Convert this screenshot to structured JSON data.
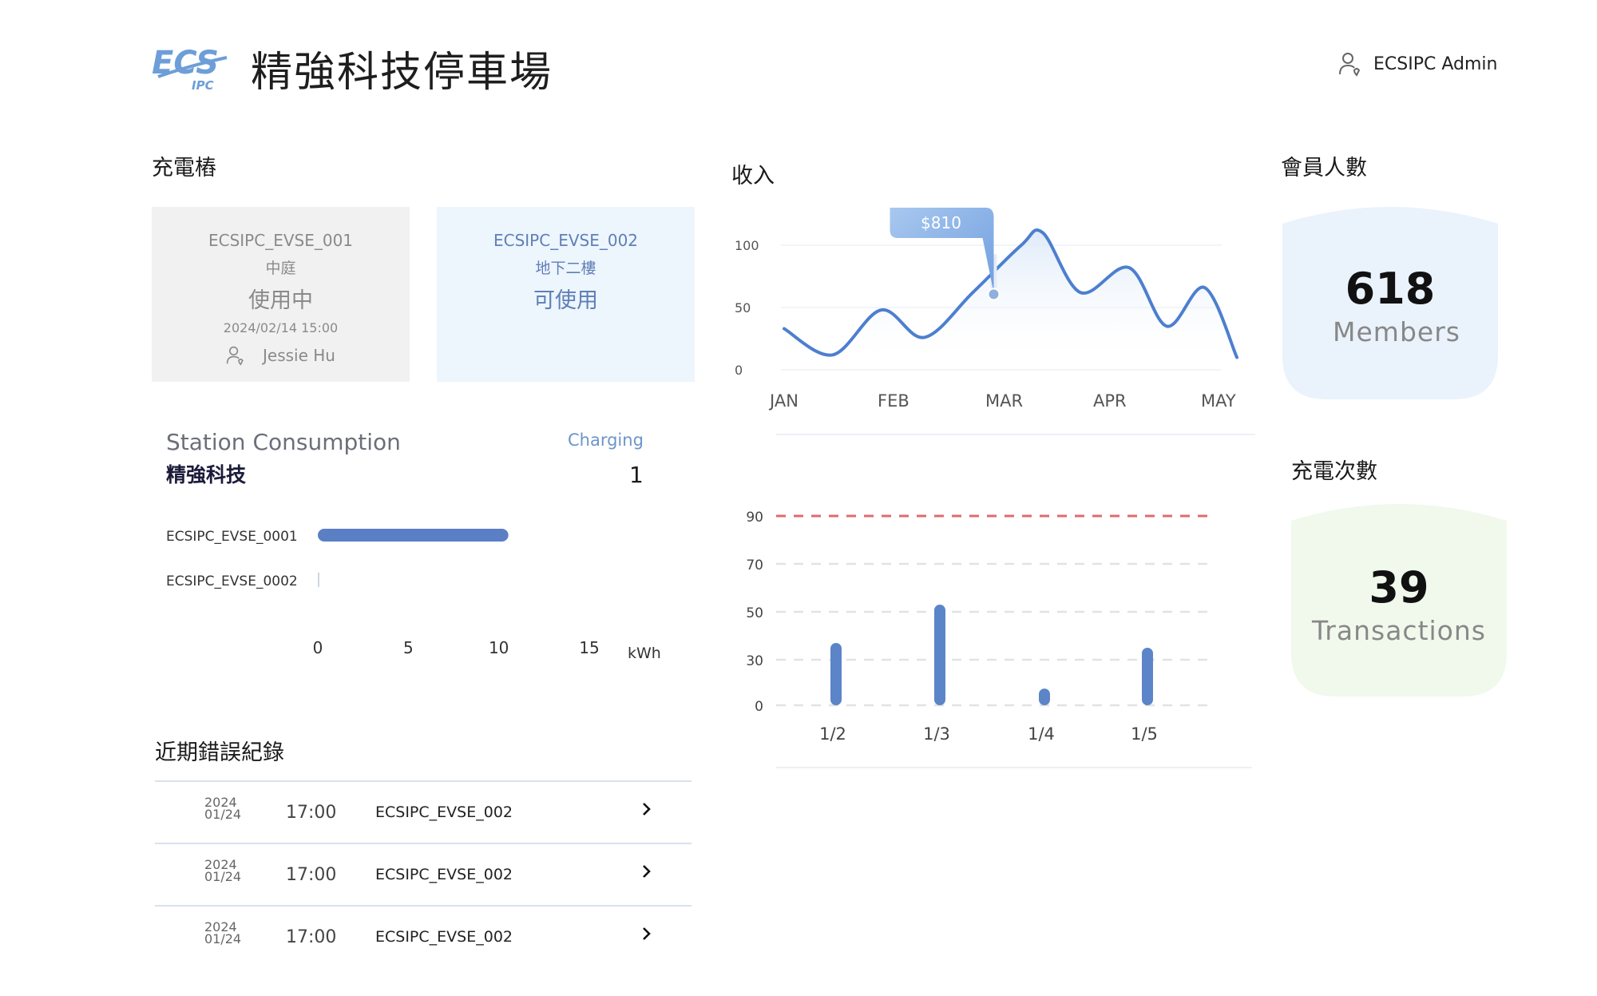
{
  "header": {
    "logo_text": "ECS",
    "logo_sub": "IPC",
    "title": "精強科技停車場",
    "user_name": "ECSIPC Admin",
    "user_icon": "user-icon"
  },
  "chargers": {
    "title": "充電樁",
    "cards": [
      {
        "name": "ECSIPC_EVSE_001",
        "location": "中庭",
        "status": "使用中",
        "time": "2024/02/14  15:00",
        "user": "Jessie Hu"
      },
      {
        "name": "ECSIPC_EVSE_002",
        "location": "地下二樓",
        "status": "可使用"
      }
    ]
  },
  "station": {
    "title": "Station Consumption",
    "subtitle": "精強科技",
    "charging_label": "Charging",
    "charging_value": "1"
  },
  "errors": {
    "title": "近期錯誤紀錄",
    "rows": [
      {
        "year": "2024",
        "date": "01/24",
        "time": "17:00",
        "name": "ECSIPC_EVSE_002"
      },
      {
        "year": "2024",
        "date": "01/24",
        "time": "17:00",
        "name": "ECSIPC_EVSE_002"
      },
      {
        "year": "2024",
        "date": "01/24",
        "time": "17:00",
        "name": "ECSIPC_EVSE_002"
      }
    ]
  },
  "revenue": {
    "title": "收入"
  },
  "members": {
    "title": "會員人數",
    "value": "618",
    "label": "Members",
    "color": "#eaf3fc"
  },
  "transactions": {
    "title": "充電次數",
    "value": "39",
    "label": "Transactions",
    "color": "#f0f9ec"
  },
  "chart_data": [
    {
      "type": "bar",
      "orientation": "horizontal",
      "categories": [
        "ECSIPC_EVSE_0001",
        "ECSIPC_EVSE_0002"
      ],
      "values": [
        10,
        0
      ],
      "xticks": [
        0,
        5,
        10,
        15
      ],
      "xlabel": "kWh",
      "xlim": [
        0,
        15
      ],
      "color": "#5b7fc4"
    },
    {
      "type": "line",
      "x": [
        "JAN",
        "FEB",
        "MAR",
        "APR",
        "MAY"
      ],
      "points": [
        [
          0,
          33
        ],
        [
          0.45,
          12
        ],
        [
          0.9,
          48
        ],
        [
          1.3,
          26
        ],
        [
          1.75,
          62
        ],
        [
          2.2,
          100
        ],
        [
          2.4,
          110
        ],
        [
          2.75,
          62
        ],
        [
          3.2,
          82
        ],
        [
          3.55,
          35
        ],
        [
          3.9,
          66
        ],
        [
          4.2,
          10
        ]
      ],
      "yticks": [
        0,
        50,
        100
      ],
      "ylim": [
        0,
        100
      ],
      "tooltip": {
        "text": "$810",
        "x": 1.9,
        "y": 85
      },
      "color": "#4d7fcf"
    },
    {
      "type": "bar",
      "categories": [
        "1/2",
        "1/3",
        "1/4",
        "1/5"
      ],
      "values": [
        37,
        53,
        11,
        35
      ],
      "yticks": [
        0,
        30,
        50,
        70,
        90
      ],
      "threshold": 90,
      "threshold_color": "#e06b6b",
      "color": "#5b85c8"
    }
  ]
}
